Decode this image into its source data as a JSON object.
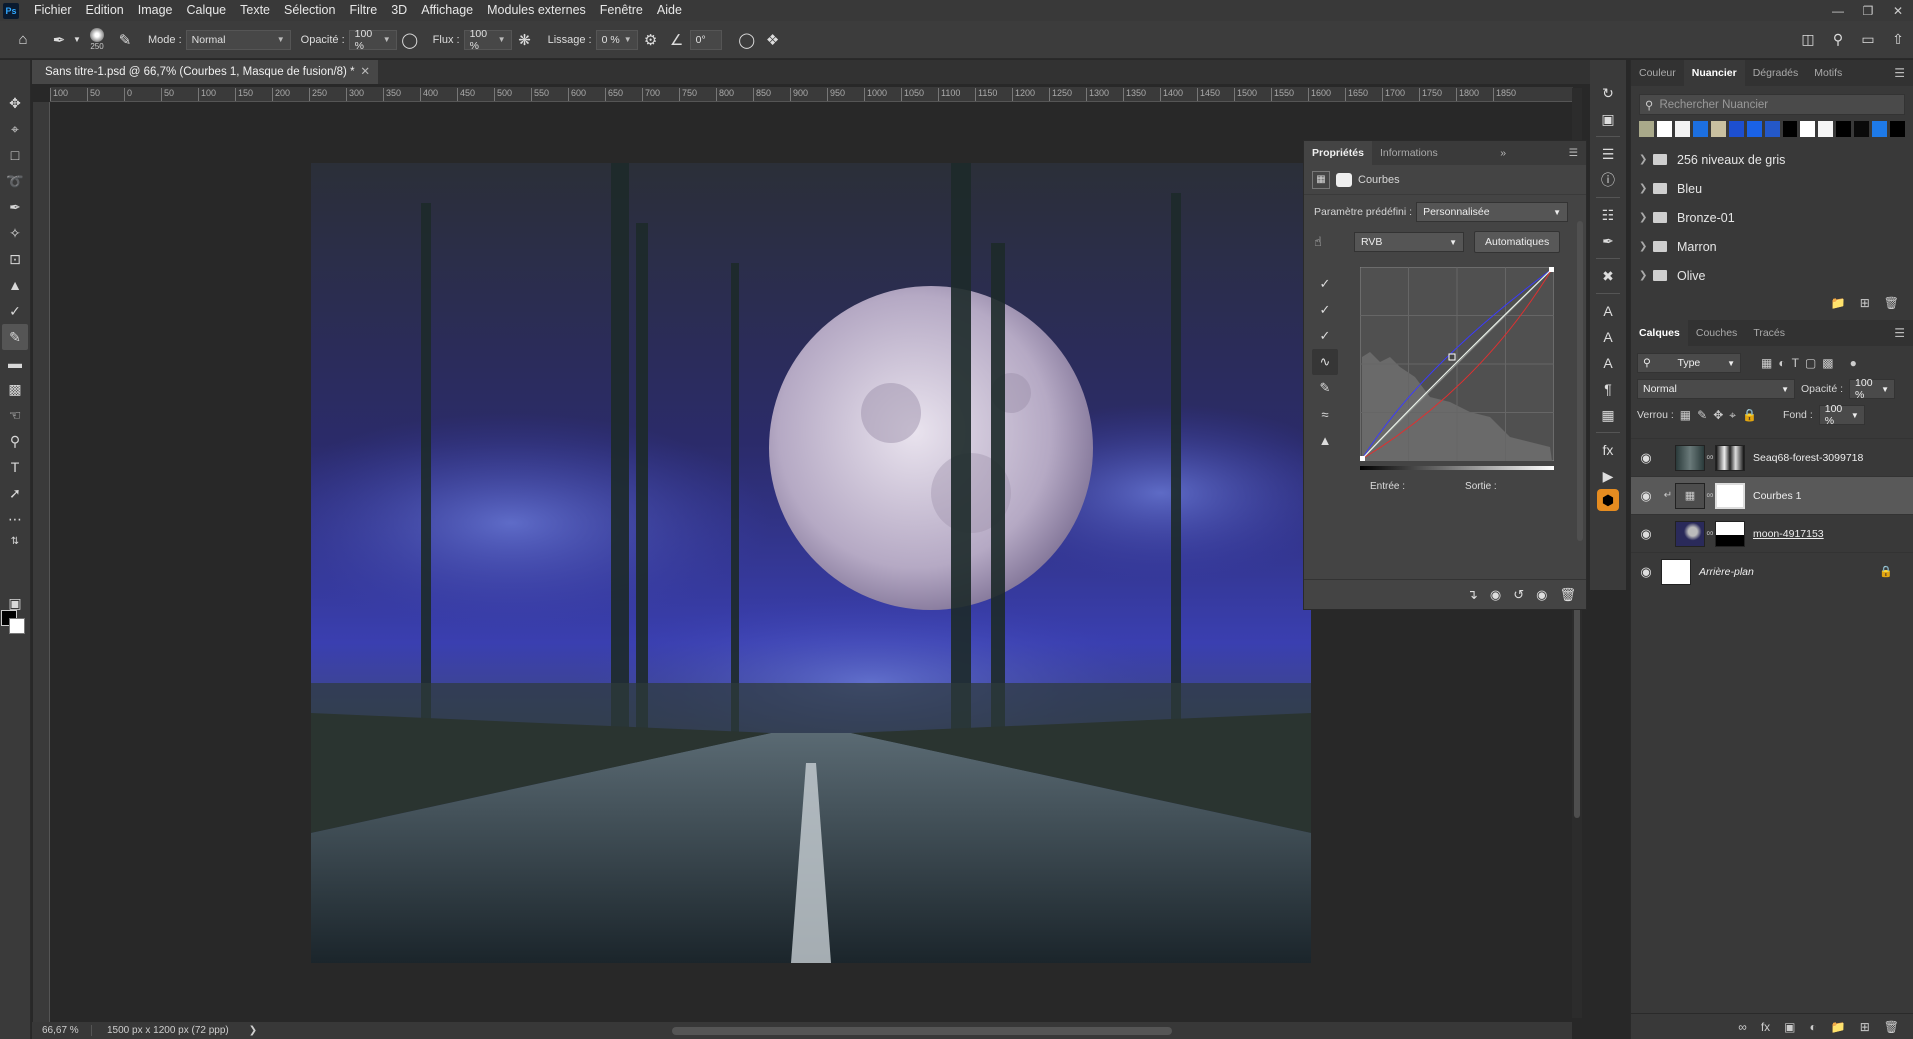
{
  "app": {
    "logo": "Ps"
  },
  "menu": [
    "Fichier",
    "Edition",
    "Image",
    "Calque",
    "Texte",
    "Sélection",
    "Filtre",
    "3D",
    "Affichage",
    "Modules externes",
    "Fenêtre",
    "Aide"
  ],
  "options": {
    "brush_size": "250",
    "mode_label": "Mode :",
    "mode_value": "Normal",
    "opacity_label": "Opacité :",
    "opacity_value": "100 %",
    "flow_label": "Flux :",
    "flow_value": "100 %",
    "smoothing_label": "Lissage :",
    "smoothing_value": "0 %",
    "angle_value": "0°"
  },
  "document": {
    "tab_title": "Sans titre-1.psd @ 66,7% (Courbes 1, Masque de fusion/8) *",
    "zoom": "66,67 %",
    "dimensions": "1500 px x 1200 px (72 ppp)"
  },
  "ruler": [
    "100",
    "50",
    "0",
    "50",
    "100",
    "150",
    "200",
    "250",
    "300",
    "350",
    "400",
    "450",
    "500",
    "550",
    "600",
    "650",
    "700",
    "750",
    "800",
    "850",
    "900",
    "950",
    "1000",
    "1050",
    "1100",
    "1150",
    "1200",
    "1250",
    "1300",
    "1350",
    "1400",
    "1450",
    "1500",
    "1550",
    "1600",
    "1650",
    "1700",
    "1750",
    "1800",
    "1850"
  ],
  "properties": {
    "tab_active": "Propriétés",
    "tab_other": "Informations",
    "title": "Courbes",
    "preset_label": "Paramètre prédéfini :",
    "preset_value": "Personnalisée",
    "channel_value": "RVB",
    "auto_button": "Automatiques",
    "input_label": "Entrée :",
    "output_label": "Sortie :"
  },
  "swatches": {
    "tabs": [
      "Couleur",
      "Nuancier",
      "Dégradés",
      "Motifs"
    ],
    "active_tab": "Nuancier",
    "search_placeholder": "Rechercher Nuancier",
    "colors": [
      "#a9a98a",
      "#ffffff",
      "#f2f2f2",
      "#1c6fe0",
      "#c9c0a0",
      "#1d4fd0",
      "#1a62e6",
      "#2458c8",
      "#000000",
      "#ffffff",
      "#f5f5f5",
      "#000000",
      "#0a0a0a",
      "#1e7ae8",
      "#000000"
    ],
    "folders": [
      "256 niveaux de gris",
      "Bleu",
      "Bronze-01",
      "Marron",
      "Olive"
    ]
  },
  "layers": {
    "tabs": [
      "Calques",
      "Couches",
      "Tracés"
    ],
    "active_tab": "Calques",
    "filter_value": "Type",
    "blend_value": "Normal",
    "opacity_label": "Opacité :",
    "opacity_value": "100 %",
    "lock_label": "Verrou :",
    "fill_label": "Fond :",
    "fill_value": "100 %",
    "items": [
      {
        "name": "Seaq68-forest-3099718",
        "selected": false
      },
      {
        "name": "Courbes 1",
        "selected": true
      },
      {
        "name": "moon-4917153",
        "selected": false
      },
      {
        "name": "Arrière-plan",
        "selected": false
      }
    ]
  },
  "colors": {
    "accent": "#31a8ff",
    "panel": "#393939",
    "selected": "#595959"
  }
}
